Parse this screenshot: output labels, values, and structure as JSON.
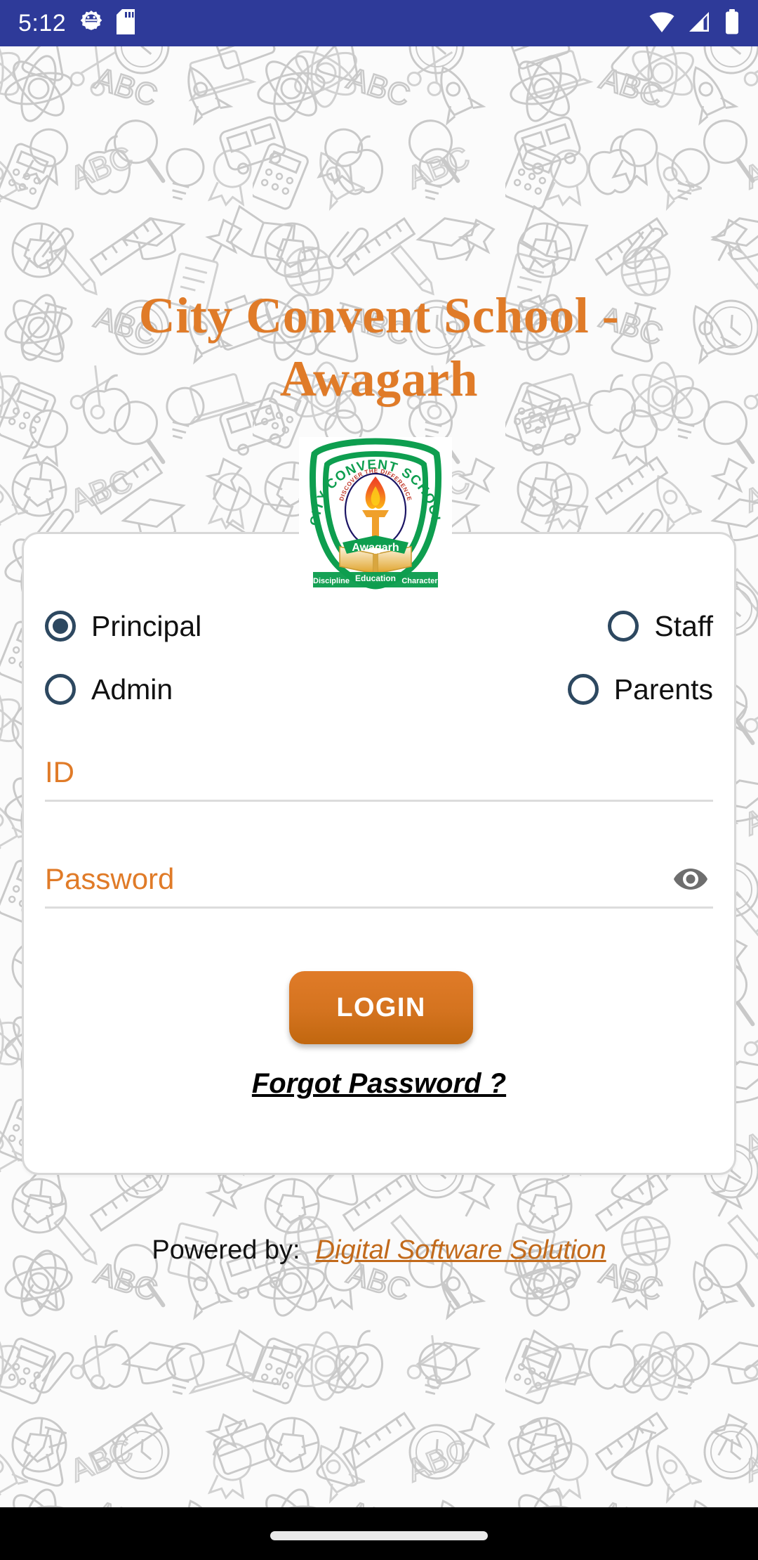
{
  "status_bar": {
    "time": "5:12",
    "background_color": "#2e3a99",
    "left_icons": [
      "android-gear-icon",
      "sd-card-icon"
    ],
    "right_icons": [
      "wifi-icon",
      "signal-icon",
      "battery-icon"
    ]
  },
  "header": {
    "school_name": "City Convent School - Awagarh",
    "title_color": "#e07b28"
  },
  "logo": {
    "name": "city-convent-school-logo",
    "arc_text": "CITY CONVENT SCHOOL",
    "inner_ring_text": "DISCOVER THE DIFFERENCE",
    "banner_text": "Awagarh",
    "motto_left": "Discipline",
    "motto_center": "Education",
    "motto_right": "Character",
    "shield_color": "#0e9e4f",
    "flame_color": "#f0641e"
  },
  "login_card": {
    "roles": [
      {
        "id": "principal",
        "label": "Principal",
        "selected": true
      },
      {
        "id": "staff",
        "label": "Staff",
        "selected": false
      },
      {
        "id": "admin",
        "label": "Admin",
        "selected": false
      },
      {
        "id": "parents",
        "label": "Parents",
        "selected": false
      }
    ],
    "radio_color": "#2d4860",
    "fields": {
      "id": {
        "placeholder": "ID",
        "value": ""
      },
      "password": {
        "placeholder": "Password",
        "value": "",
        "visibility_icon": "eye-icon"
      }
    },
    "login_button": {
      "label": "LOGIN",
      "color": "#d4731f"
    },
    "forgot_password": {
      "label": "Forgot Password ?"
    }
  },
  "footer": {
    "powered_by_label": "Powered by:",
    "vendor_name": "Digital Software Solution",
    "vendor_color": "#c26a1b"
  },
  "nav_bar": {
    "home_indicator": "home-indicator"
  }
}
